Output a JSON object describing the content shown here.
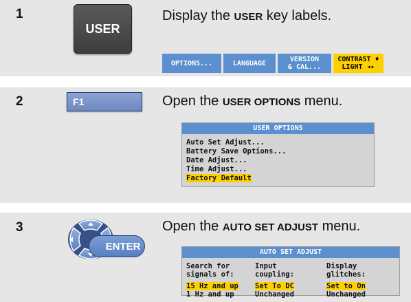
{
  "steps": [
    {
      "number": "1",
      "key_label": "USER",
      "instruction": {
        "pre": "Display the ",
        "bold": "USER",
        "post": " key labels."
      },
      "softkeys": [
        {
          "label": "OPTIONS...",
          "highlighted": false
        },
        {
          "label": "LANGUAGE",
          "highlighted": false
        },
        {
          "label": "VERSION\n& CAL...",
          "highlighted": false
        },
        {
          "label": "CONTRAST ♦\nLIGHT ◂▸",
          "highlighted": true
        }
      ]
    },
    {
      "number": "2",
      "key_label": "F1",
      "instruction": {
        "pre": "Open the ",
        "bold": "USER OPTIONS",
        "post": " menu."
      },
      "menu": {
        "title": "USER OPTIONS",
        "items": [
          "Auto Set Adjust...",
          "Battery Save Options...",
          "Date Adjust...",
          "Time Adjust...",
          "Factory Default"
        ],
        "selected_index": 4
      }
    },
    {
      "number": "3",
      "key_label": "ENTER",
      "instruction": {
        "pre": "Open the ",
        "bold": "AUTO SET ADJUST",
        "post": " menu."
      },
      "menu": {
        "title": "AUTO SET ADJUST",
        "columns": [
          {
            "header": [
              "Search for",
              "signals of:"
            ],
            "options": [
              "15 Hz and up",
              "1 Hz and up"
            ],
            "selected_index": 0
          },
          {
            "header": [
              "Input",
              "coupling:"
            ],
            "options": [
              "Set To DC",
              "Unchanged"
            ],
            "selected_index": 0
          },
          {
            "header": [
              "Display",
              "glitches:"
            ],
            "options": [
              "Set to On",
              "Unchanged"
            ],
            "selected_index": 0
          }
        ]
      }
    }
  ],
  "colors": {
    "band": "#e6e6e6",
    "softkey": "#5b8fcd",
    "highlight": "#ffd000",
    "key_dark": "#4a4a4a"
  },
  "icons": [
    "navigation-keypad-icon"
  ]
}
